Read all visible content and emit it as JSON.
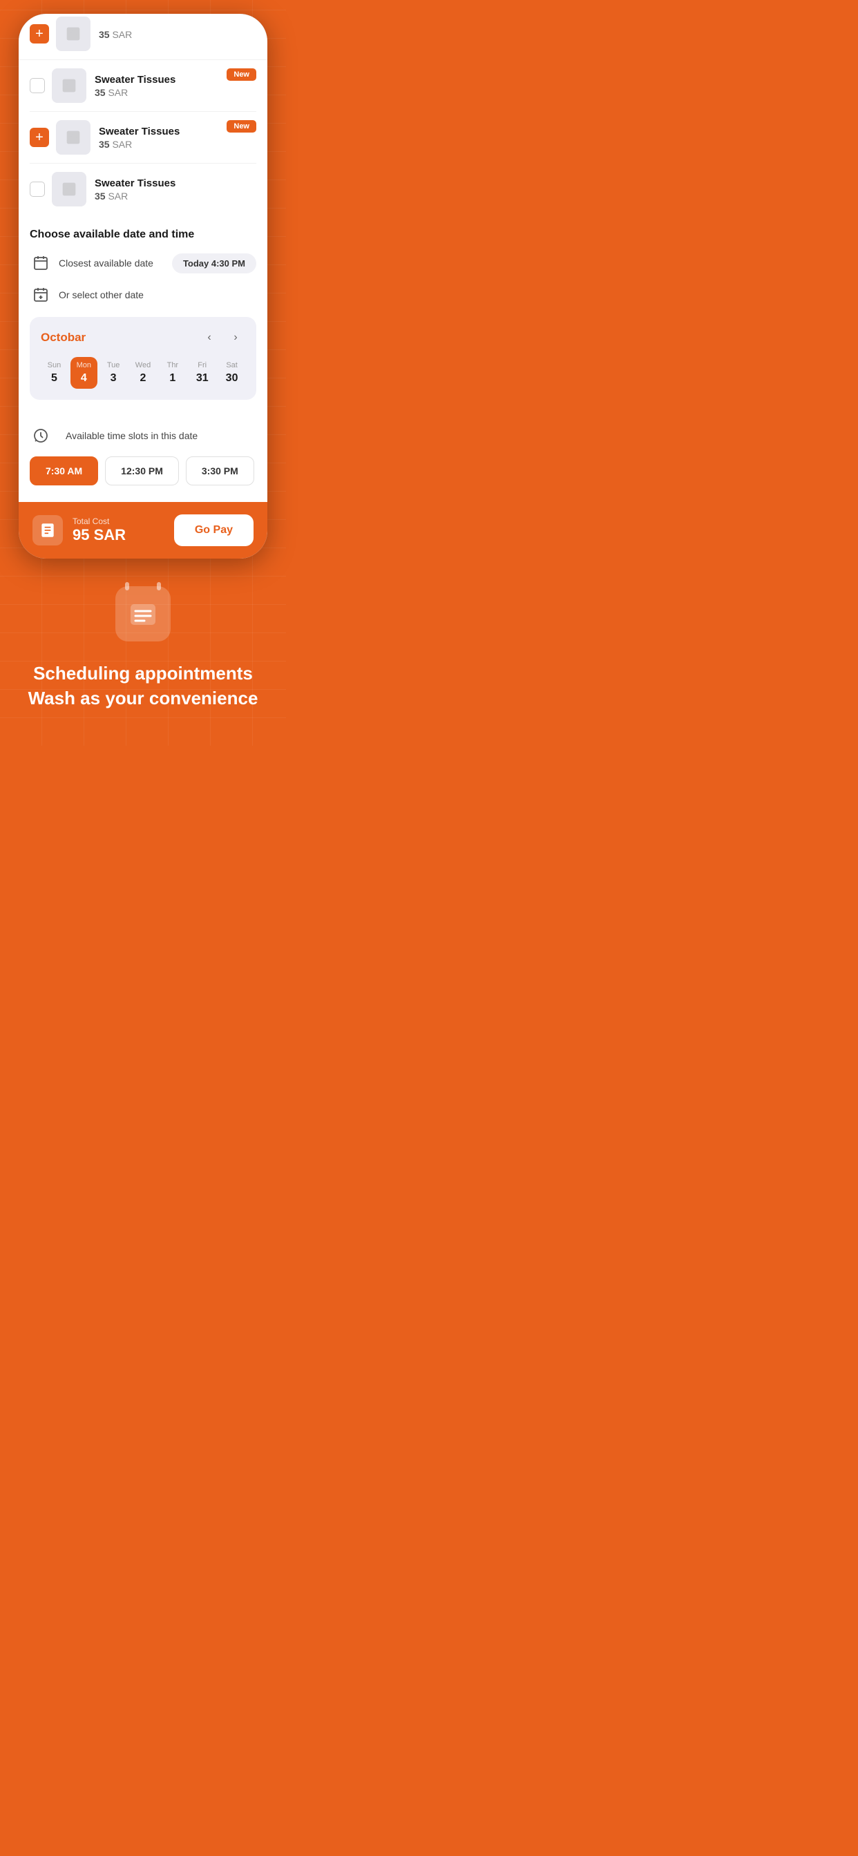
{
  "products": [
    {
      "id": 1,
      "name": "Sweater Tissues",
      "price": "35",
      "currency": "SAR",
      "hasCheckbox": true,
      "hasAddBtn": false,
      "isNew": false,
      "isPartial": true
    },
    {
      "id": 2,
      "name": "Sweater Tissues",
      "price": "35",
      "currency": "SAR",
      "hasCheckbox": true,
      "hasAddBtn": false,
      "isNew": true
    },
    {
      "id": 3,
      "name": "Sweater Tissues",
      "price": "35",
      "currency": "SAR",
      "hasCheckbox": false,
      "hasAddBtn": true,
      "isNew": true
    },
    {
      "id": 4,
      "name": "Sweater Tissues",
      "price": "35",
      "currency": "SAR",
      "hasCheckbox": true,
      "hasAddBtn": false,
      "isNew": false
    }
  ],
  "dateSection": {
    "title": "Choose available date and time",
    "closestLabel": "Closest available date",
    "closestValue": "Today 4:30 PM",
    "otherLabel": "Or select other date"
  },
  "calendar": {
    "month": "Octobar",
    "days": [
      {
        "name": "Sun",
        "num": "5",
        "selected": false
      },
      {
        "name": "Mon",
        "num": "4",
        "selected": true
      },
      {
        "name": "Tue",
        "num": "3",
        "selected": false
      },
      {
        "name": "Wed",
        "num": "2",
        "selected": false
      },
      {
        "name": "Thr",
        "num": "1",
        "selected": false
      },
      {
        "name": "Fri",
        "num": "31",
        "selected": false
      },
      {
        "name": "Sat",
        "num": "30",
        "selected": false
      }
    ]
  },
  "timeSlots": {
    "label": "Available time slots in this date",
    "slots": [
      {
        "time": "7:30 AM",
        "active": true
      },
      {
        "time": "12:30 PM",
        "active": false
      },
      {
        "time": "3:30 PM",
        "active": false
      }
    ]
  },
  "bottomBar": {
    "costLabel": "Total Cost",
    "costValue": "95 SAR",
    "payBtn": "Go Pay"
  },
  "marketing": {
    "line1": "Scheduling appointments",
    "line2": "Wash as your convenience"
  },
  "badges": {
    "new": "New"
  }
}
